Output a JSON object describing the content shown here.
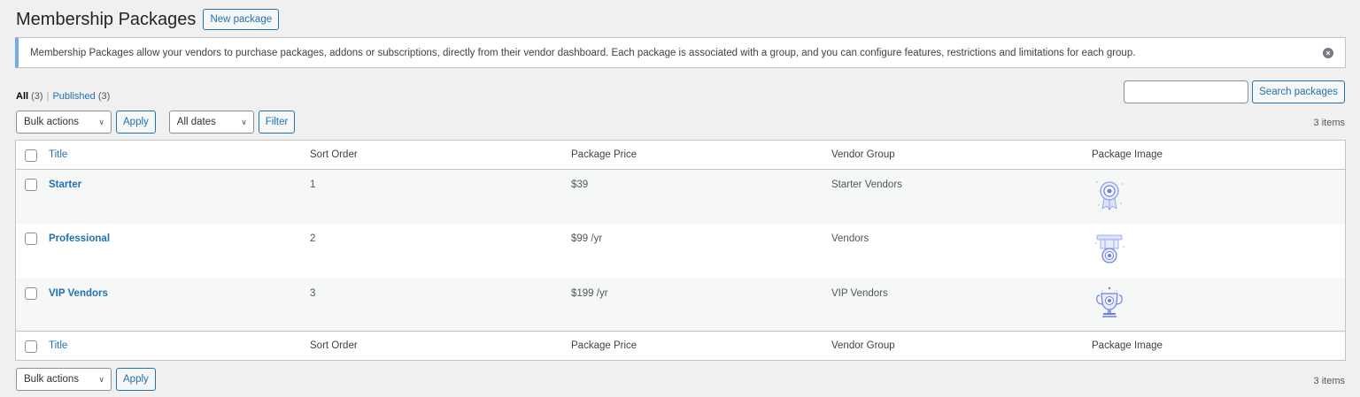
{
  "page": {
    "title": "Membership Packages",
    "new_button": "New package"
  },
  "notice": {
    "text": "Membership Packages allow your vendors to purchase packages, addons or subscriptions, directly from their vendor dashboard. Each package is associated with a group, and you can configure features, restrictions and limitations for each group."
  },
  "filters": {
    "all_label": "All",
    "all_count": "(3)",
    "separator": "|",
    "published_label": "Published",
    "published_count": "(3)"
  },
  "search": {
    "value": "",
    "button": "Search packages"
  },
  "tablenav": {
    "bulk_actions": "Bulk actions",
    "apply": "Apply",
    "dates": "All dates",
    "filter": "Filter",
    "items_count": "3 items"
  },
  "table": {
    "columns": {
      "title": "Title",
      "sort_order": "Sort Order",
      "price": "Package Price",
      "group": "Vendor Group",
      "image": "Package Image"
    },
    "rows": [
      {
        "title": "Starter",
        "sort_order": "1",
        "price": "$39",
        "group": "Starter Vendors",
        "image_icon": "medal-icon"
      },
      {
        "title": "Professional",
        "sort_order": "2",
        "price": "$99 /yr",
        "group": "Vendors",
        "image_icon": "badge-icon"
      },
      {
        "title": "VIP Vendors",
        "sort_order": "3",
        "price": "$199 /yr",
        "group": "VIP Vendors",
        "image_icon": "trophy-icon"
      }
    ]
  },
  "colors": {
    "accent": "#2271b1",
    "notice_border": "#72aee6",
    "icon_blue": "#6b7fe0"
  }
}
